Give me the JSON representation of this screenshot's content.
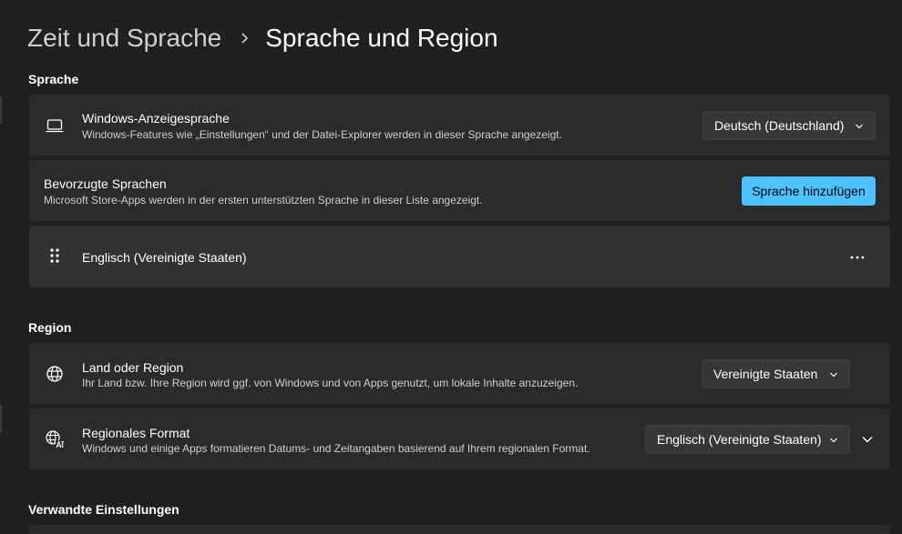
{
  "breadcrumb": {
    "parent": "Zeit und Sprache",
    "current": "Sprache und Region"
  },
  "sprache": {
    "heading": "Sprache",
    "display_language": {
      "title": "Windows-Anzeigesprache",
      "description": "Windows-Features wie „Einstellungen“ und der Datei-Explorer werden in dieser Sprache angezeigt.",
      "value": "Deutsch (Deutschland)",
      "icon": "laptop-icon"
    },
    "preferred": {
      "title": "Bevorzugte Sprachen",
      "description": "Microsoft Store-Apps werden in der ersten unterstützten Sprache in dieser Liste angezeigt.",
      "button": "Sprache hinzufügen"
    },
    "languages": [
      {
        "name": "Englisch (Vereinigte Staaten)"
      }
    ]
  },
  "region": {
    "heading": "Region",
    "country": {
      "title": "Land oder Region",
      "description": "Ihr Land bzw. Ihre Region wird ggf. von Windows und von Apps genutzt, um lokale Inhalte anzuzeigen.",
      "value": "Vereinigte Staaten",
      "icon": "globe-icon"
    },
    "format": {
      "title": "Regionales Format",
      "description": "Windows und einige Apps formatieren Datums- und Zeitangaben basierend auf Ihrem regionalen Format.",
      "value": "Englisch (Vereinigte Staaten)",
      "icon": "regional-format-icon"
    }
  },
  "related": {
    "heading": "Verwandte Einstellungen"
  },
  "colors": {
    "accent": "#4cc2ff",
    "background": "#202020",
    "card": "#2b2b2b"
  }
}
